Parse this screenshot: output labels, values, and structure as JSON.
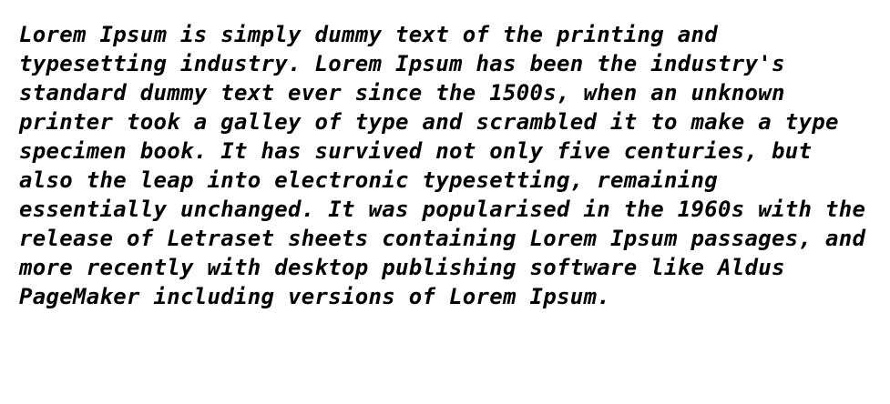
{
  "document": {
    "lines": [
      "Lorem Ipsum is simply dummy text of the printing and",
      "typesetting industry. Lorem Ipsum has been the industry's",
      "standard dummy text ever since the 1500s, when an unknown",
      "printer took a galley of type and scrambled it to make a type",
      "specimen book. It has survived not only five centuries, but",
      "also the leap into electronic typesetting, remaining",
      "essentially unchanged. It was popularised in the 1960s with the",
      "release of Letraset sheets containing Lorem Ipsum passages, and",
      "more recently with desktop publishing software like Aldus",
      "PageMaker including versions of Lorem Ipsum."
    ],
    "text_color": "#000000",
    "background_color": "#ffffff"
  }
}
